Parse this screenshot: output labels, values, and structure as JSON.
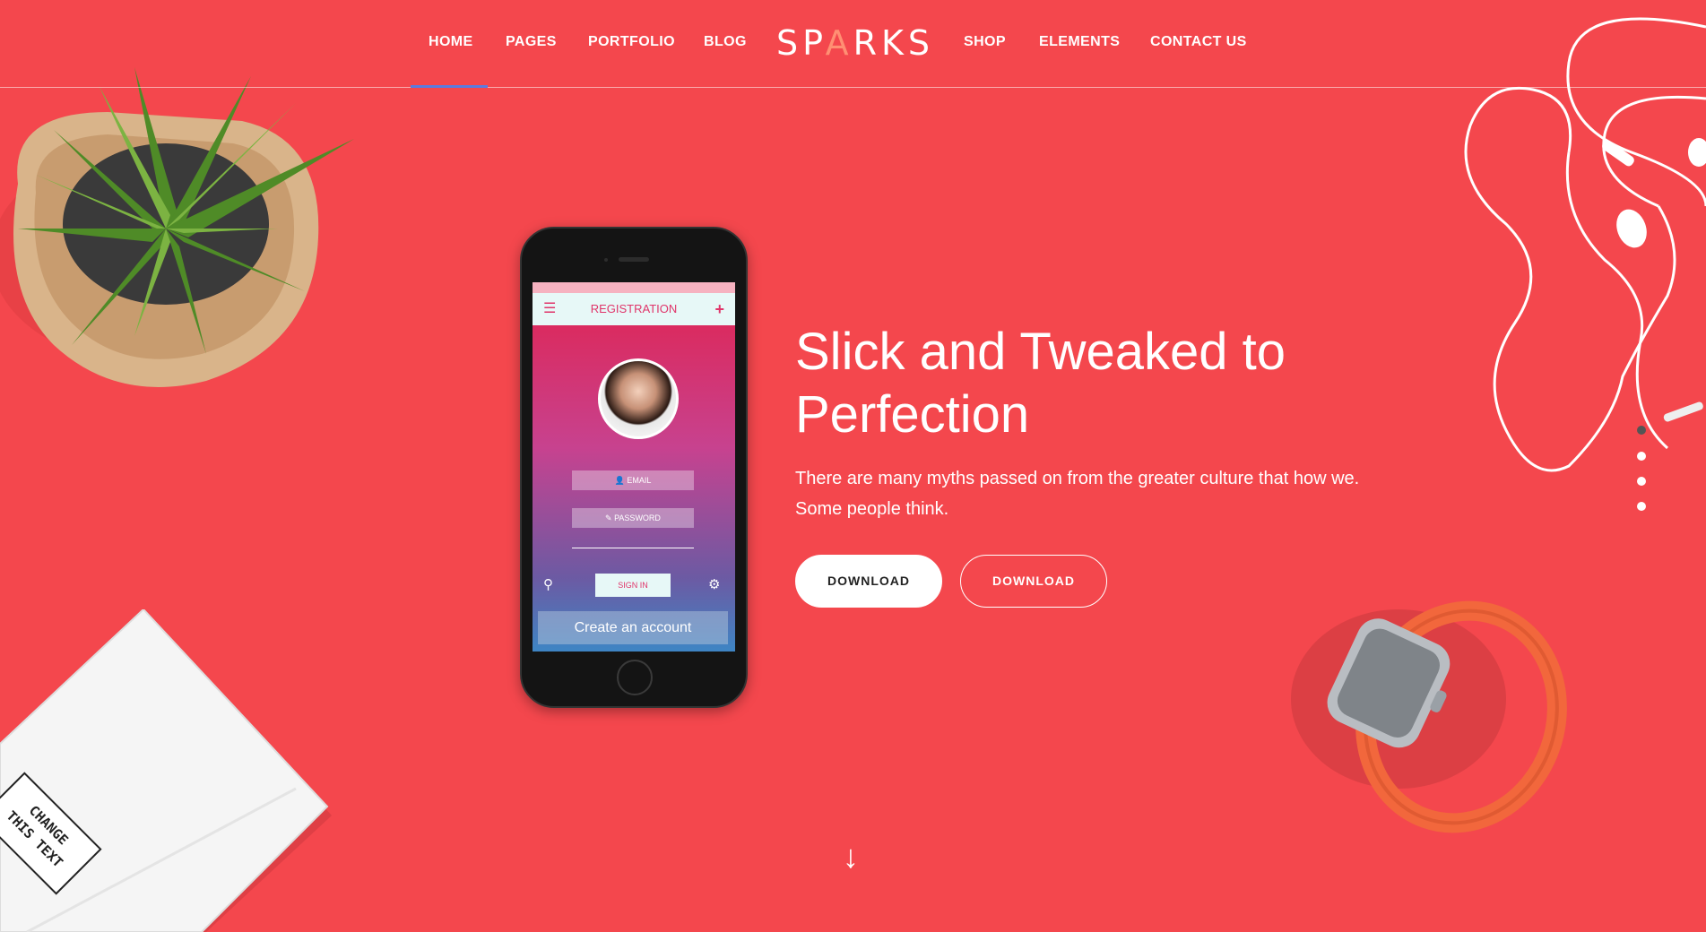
{
  "nav": {
    "left_items": [
      "HOME",
      "PAGES",
      "PORTFOLIO",
      "BLOG"
    ],
    "right_items": [
      "SHOP",
      "ELEMENTS",
      "CONTACT US"
    ],
    "active": "HOME",
    "logo": {
      "part1": "SP",
      "accent": "A",
      "part2": "RKS"
    }
  },
  "hero": {
    "background_color": "#f4474d",
    "headline": "Slick and Tweaked to Perfection",
    "headline_line1": "Slick and Tweaked to",
    "headline_line2": "Perfection",
    "subtext": "There are many myths passed on from the greater culture that how we. Some people think.",
    "buttons": {
      "primary": "DOWNLOAD",
      "secondary": "DOWNLOAD"
    },
    "slider_dots": 4,
    "active_dot": 0
  },
  "phone_screen": {
    "header": "REGISTRATION",
    "email_placeholder": "EMAIL",
    "password_placeholder": "PASSWORD",
    "signin_label": "SIGN IN",
    "create_account": "Create an account"
  },
  "notebook": {
    "cover_text": "CHANGE THIS TEXT"
  },
  "icons": {
    "hamburger": "hamburger-icon",
    "plus": "plus-icon",
    "search": "search-icon",
    "settings": "gear-icon",
    "scroll": "arrow-down-icon"
  }
}
